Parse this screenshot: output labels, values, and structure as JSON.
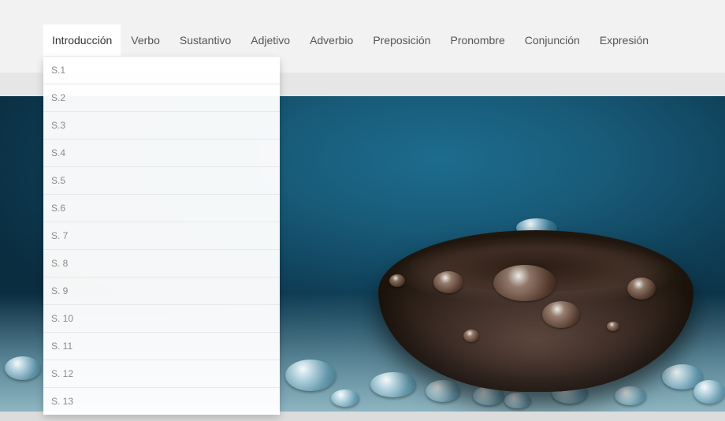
{
  "nav": {
    "items": [
      {
        "label": "Introducción",
        "active": true
      },
      {
        "label": "Verbo"
      },
      {
        "label": "Sustantivo"
      },
      {
        "label": "Adjetivo"
      },
      {
        "label": "Adverbio"
      },
      {
        "label": "Preposición"
      },
      {
        "label": "Pronombre"
      },
      {
        "label": "Conjunción"
      },
      {
        "label": "Expresión"
      }
    ]
  },
  "dropdown": {
    "items": [
      "S.1",
      "S.2",
      "S.3",
      "S.4",
      "S.5",
      "S.6",
      "S. 7",
      "S. 8",
      "S. 9",
      "S. 10",
      "S. 11",
      "S. 12",
      "S. 13"
    ]
  },
  "colors": {
    "topbar": "#f2f2f2",
    "subbar": "#e6e6e6",
    "hero_blue": "#185a78",
    "bean_brown": "#3d2d26",
    "nav_text": "#555555",
    "dropdown_text": "#8a8a8a"
  }
}
